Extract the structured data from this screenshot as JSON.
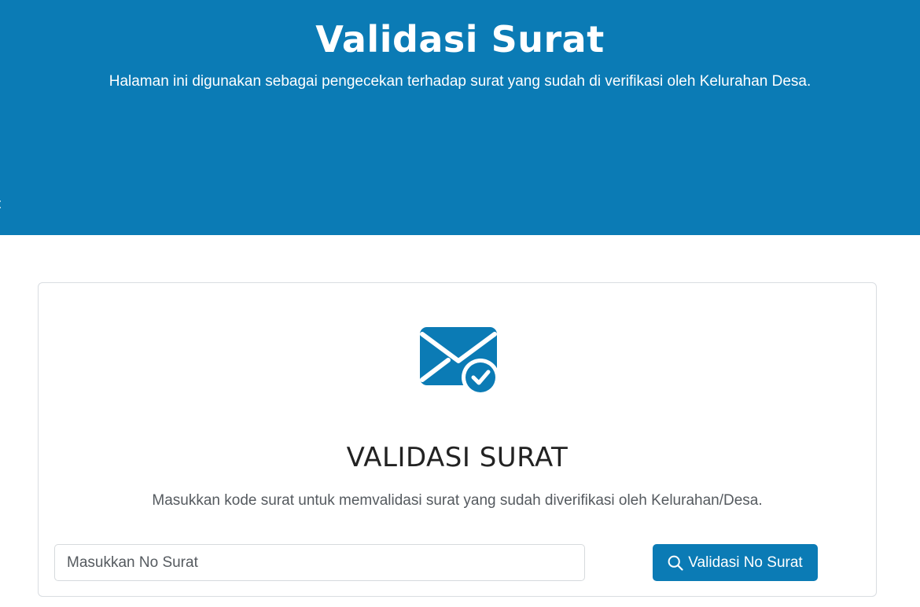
{
  "hero": {
    "title": "Validasi Surat",
    "subtitle": "Halaman ini digunakan sebagai pengecekan terhadap surat yang sudah di verifikasi oleh Kelurahan Desa.",
    "breadcrumb_fragment": "rat"
  },
  "card": {
    "icon": "envelope-check-icon",
    "title": "VALIDASI SURAT",
    "description": "Masukkan kode surat untuk memvalidasi surat yang sudah diverifikasi oleh Kelurahan/Desa.",
    "input": {
      "value": "",
      "placeholder": "Masukkan No Surat"
    },
    "button": {
      "icon": "search-icon",
      "label": "Validasi No Surat"
    }
  },
  "colors": {
    "brand": "#0b7bb5",
    "card_border": "#d9dde1",
    "text_muted": "#555a5f",
    "heading": "#222222"
  }
}
